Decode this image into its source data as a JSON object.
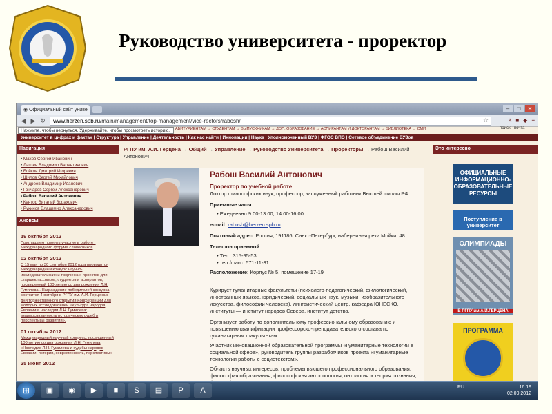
{
  "slide": {
    "title": "Руководство университета - проректор"
  },
  "browser": {
    "tab_title": "Официальный сайт униве",
    "url_host": "www.herzen.spb.ru",
    "url_path": "/main/management/top-management/vice-rectors/rabosh/",
    "tooltip": "Нажмите, чтобы вернуться. Удерживайте, чтобы просмотреть историю.",
    "min": "–",
    "max": "□",
    "close": "✕"
  },
  "site_nav_top": "АБИТУРИЕНТАМ → СТУДЕНТАМ → ВЫПУСКНИКАМ → ДОП. ОБРАЗОВАНИЕ → АСПИРАНТАМ И ДОКТОРАНТАМ → БИБЛИОТЕКА → СМИ",
  "site_nav_right": "поиск · почта",
  "menu": "Университет в цифрах и фактах | Структура | Управление | Деятельность | Как нас найти | Инновации | Наука | Уполномоченный ВУЗ | ФГОС ВПО | Сетевое объединение ВУЗов",
  "left": {
    "nav_title": "Навигация",
    "people": [
      "Махов Сергей Иванович",
      "Лаптев Владимир Валентинович",
      "Бойков Дмитрий Игоревич",
      "Шилов Сергей Михайлович",
      "Андреев Владимир Иванович",
      "Гончаров Сергей Александрович",
      "Рабош Василий Антонович",
      "Кантор Виталий Зорахович",
      "Рукинов Владимир Александрович"
    ],
    "news_title": "Анонсы",
    "news": [
      {
        "date": "19 октября 2012",
        "text": "Приглашаем принять участие в работе I Международного форума словесников"
      },
      {
        "date": "02 октября 2012",
        "text": "С 15 мая по 30 сентября 2012 года проводится Международный конкурс научно-исследовательских и творческих проектов для старшеклассников, студентов и аспирантов, посвященный 100-летию со дня рождения Л.Н. Гумилева . Награждение победителей конкурса состоится 4 октября в РГПУ им. А.И. Герцена в дни торжественного открытия Конференции для молодых исследователей «Культура народов Евразии в наследии Л.Н. Гумилева: взаимосвязанность исторических судеб и перспективы развития»."
      },
      {
        "date": "01 октября 2012",
        "text": "Международный научный конгресс, посвященный 100-летию со дня рождения Л.Н. Гумилева «Наследие Л.Н. Гумилева и судьбы народов Евразии: история, современность, перспективы»"
      },
      {
        "date": "25 июня 2012",
        "text": ""
      }
    ]
  },
  "breadcrumb": {
    "items": [
      "РГПУ им. А.И. Герцена",
      "Общий",
      "Управление",
      "Руководство Университета",
      "Проректоры"
    ],
    "current": "Рабош Василий Антонович",
    "sep": " → "
  },
  "person": {
    "name": "Рабош Василий Антонович",
    "position": "Проректор по учебной работе",
    "degree": "Доктор философских наук, профессор, заслуженный работник Высшей школы РФ",
    "hours_label": "Приемные часы:",
    "hours": "Ежедневно 9.00-13.00, 14.00-16.00",
    "email_label": "e-mail:",
    "email": "rabosh@herzen.spb.ru",
    "address_label": "Почтовый адрес:",
    "address": "Россия, 191186, Санкт-Петербург, набережная реки Мойки, 48.",
    "phone_label": "Телефон приемной:",
    "phone1": "Тел.: 315-95-53",
    "phone2": "тел./факс: 571-11-31",
    "location_label": "Расположение:",
    "location": "Корпус № 5, помещение 17-19",
    "para1": "Курирует гуманитарные факультеты (психолого-педагогический, филологический, иностранных языков, юридический, социальных наук, музыки, изобразительного искусства, философии человека), лингвистический центр, кафедра ЮНЕСКО, институты — институт народов Севера, институт детства.",
    "para2": "Организует работу по дополнительному профессиональному образованию и повышению квалификации профессорско-преподавательского состава по гуманитарным факультетам.",
    "para3": "Участник инновационной образовательной программы «Гуманитарные технологии в социальной сфере», руководитель группы разработчиков проекта «Гуманитарные технологии работы с социотекстом».",
    "para4": "Область научных интересов: проблемы высшего профессионального образования, философия образования, философская антропология, онтология и теория познания, философия науки, синергетика."
  },
  "right": {
    "title": "Это интересно",
    "banner1": "ОФИЦИАЛЬНЫЕ ИНФОРМАЦИОННО-ОБРАЗОВАТЕЛЬНЫЕ РЕСУРСЫ",
    "banner2": "Поступление в университет",
    "banner3": "ОЛИМПИАДЫ",
    "banner3_caption": "В РГПУ им.А.И.ГЕРЦЕНА",
    "banner4": "ПРОГРАММА"
  },
  "taskbar": {
    "lang": "RU",
    "time": "16:19",
    "date": "02.09.2012"
  },
  "colors": {
    "brand": "#6b1d1d",
    "slide_line": "#2e5a8c"
  }
}
